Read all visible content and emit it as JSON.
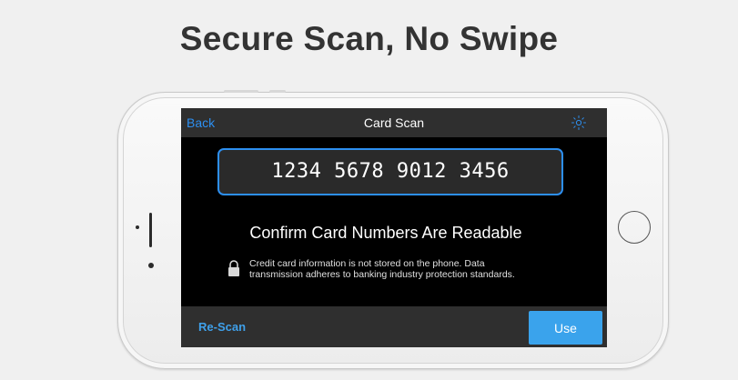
{
  "headline": "Secure Scan, No Swipe",
  "colors": {
    "accent": "#2d8ff0",
    "use_button": "#3aa3ec",
    "screen_background": "#000000",
    "bar_background": "#2f2f2f"
  },
  "navbar": {
    "back_label": "Back",
    "title": "Card Scan",
    "brightness_icon": "brightness-icon"
  },
  "card": {
    "number": "1234 5678 9012 3456"
  },
  "confirm_text": "Confirm Card Numbers Are Readable",
  "disclaimer": {
    "icon": "lock-icon",
    "line1": "Credit card information is not stored on the phone. Data",
    "line2": "transmission adheres to banking industry protection standards."
  },
  "bottombar": {
    "rescan_label": "Re-Scan",
    "use_label": "Use"
  }
}
